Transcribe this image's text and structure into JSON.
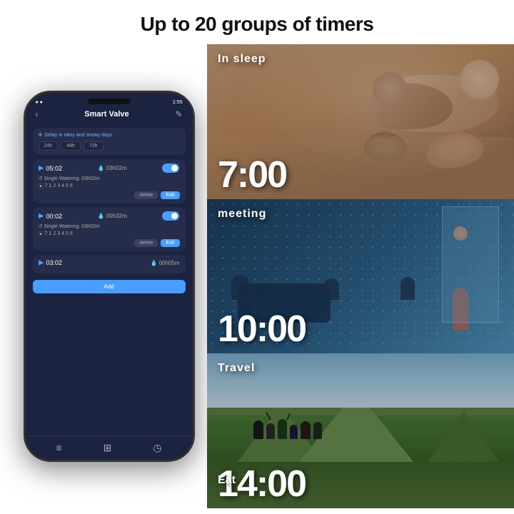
{
  "header": {
    "title": "Up to 20 groups of timers"
  },
  "phone": {
    "status": {
      "left": "● ●",
      "signal": "●●●●",
      "time": "1:55",
      "battery": "🔋"
    },
    "nav": {
      "back": "‹",
      "title": "Smart Valve",
      "edit": "✎"
    },
    "rain_delay": {
      "label": "Delay in rainy and snowy days",
      "options": [
        "24h",
        "48h",
        "72h"
      ]
    },
    "timers": [
      {
        "time": "05:02",
        "duration": "03h02m",
        "toggle": true,
        "single_watering": "Single Watering: 03h02m",
        "days": [
          "■",
          "7",
          "1",
          "2",
          "3",
          "4",
          "5",
          "6"
        ]
      },
      {
        "time": "00:02",
        "duration": "00h32m",
        "toggle": true,
        "single_watering": "Single Watering: 03h02m",
        "days": [
          "■",
          "7",
          "1",
          "2",
          "3",
          "4",
          "5",
          "6"
        ]
      },
      {
        "time": "03:02",
        "duration": "00h05m",
        "toggle": false
      }
    ],
    "buttons": {
      "delete": "delete",
      "edit": "Edit",
      "add": "Add"
    },
    "bottom_nav": [
      "≡",
      "⊞",
      "◷"
    ]
  },
  "scenes": [
    {
      "id": "sleep",
      "label": "In sleep",
      "time": "7:00",
      "theme": "warm"
    },
    {
      "id": "meeting",
      "label": "meeting",
      "time": "10:00",
      "theme": "cool"
    },
    {
      "id": "travel",
      "label": "Travel",
      "time": "14:00",
      "theme": "nature"
    }
  ],
  "eat_label": "Eat"
}
